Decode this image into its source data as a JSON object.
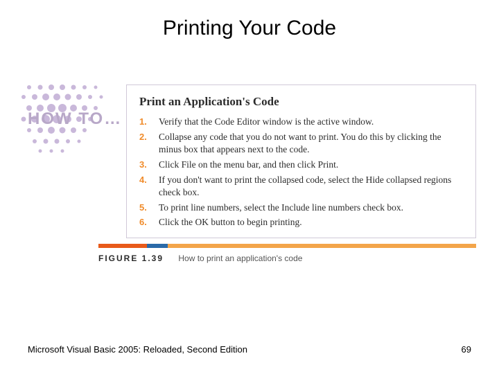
{
  "title": "Printing Your Code",
  "howto_label": "HOW TO…",
  "panel_title": "Print an Application's Code",
  "steps": [
    "Verify that the Code Editor window is the active window.",
    "Collapse any code that you do not want to print. You do this by clicking the minus box that appears next to the code.",
    "Click File on the menu bar, and then click Print.",
    "If you don't want to print the collapsed code, select the Hide collapsed regions check box.",
    "To print line numbers, select the Include line numbers check box.",
    "Click the OK button to begin printing."
  ],
  "figure_label": "FIGURE 1.39",
  "figure_caption": "How to print an application's code",
  "footer_left": "Microsoft Visual Basic 2005: Reloaded, Second Edition",
  "footer_right": "69"
}
